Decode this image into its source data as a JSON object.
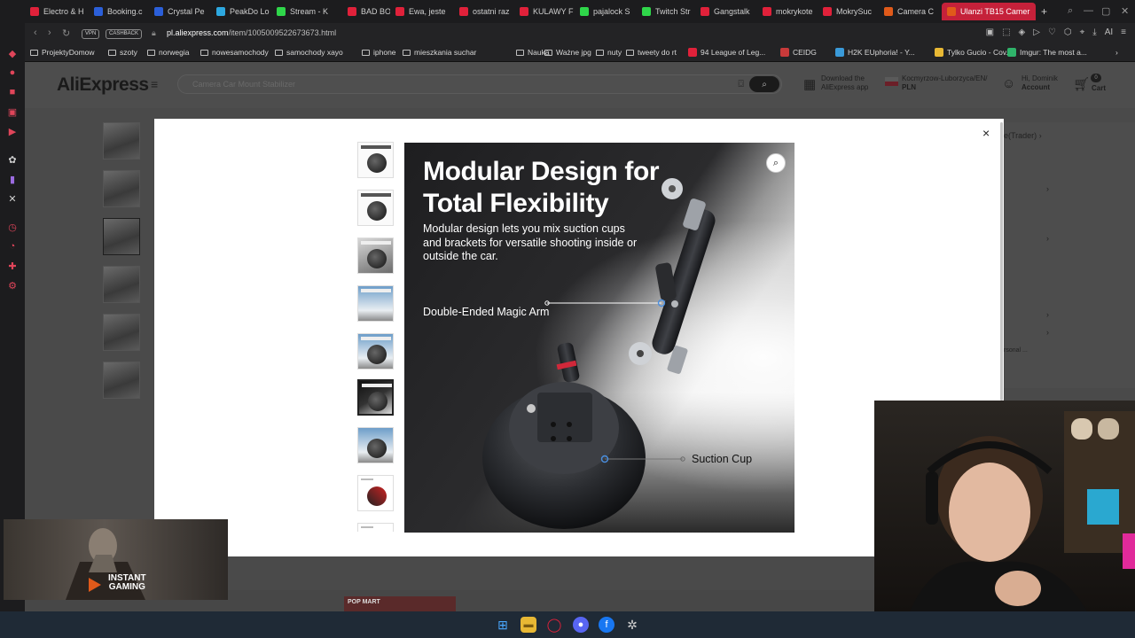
{
  "browser": {
    "tabs": [
      {
        "label": "Electro & H",
        "color": "#e0213a"
      },
      {
        "label": "Booking.c",
        "color": "#2b5fd9"
      },
      {
        "label": "Crystal Pe",
        "color": "#2b5fd9"
      },
      {
        "label": "PeakDo Lo",
        "color": "#2da8e0"
      },
      {
        "label": "Stream - K",
        "color": "#2fd64a"
      },
      {
        "label": "BAD BOY",
        "color": "#e0213a"
      },
      {
        "label": "Ewa, jeste",
        "color": "#e0213a"
      },
      {
        "label": "ostatni raz",
        "color": "#e0213a"
      },
      {
        "label": "KULAWY F",
        "color": "#e0213a"
      },
      {
        "label": "pajalock S",
        "color": "#2fd64a"
      },
      {
        "label": "Twitch Str",
        "color": "#2fd64a"
      },
      {
        "label": "Gangstalk",
        "color": "#e0213a"
      },
      {
        "label": "mokrykote",
        "color": "#e0213a"
      },
      {
        "label": "MokrySuc",
        "color": "#e0213a"
      },
      {
        "label": "Camera C",
        "color": "#e05a1a"
      },
      {
        "label": "Ulanzi TB15 Camer",
        "color": "#e05a1a"
      }
    ],
    "new_tab": "+",
    "vpn_chip": "VPN",
    "cashback_chip": "CASHBACK",
    "url_domain": "pl.aliexpress.com",
    "url_path": "/item/1005009522673673.html",
    "bookmarks": [
      {
        "label": "ProjektyDomow",
        "type": "folder"
      },
      {
        "label": "szoty",
        "type": "folder"
      },
      {
        "label": "norwegia",
        "type": "folder"
      },
      {
        "label": "nowesamochody",
        "type": "folder"
      },
      {
        "label": "samochody xayo",
        "type": "folder"
      },
      {
        "label": "iphone",
        "type": "folder"
      },
      {
        "label": "mieszkania suchar",
        "type": "folder"
      },
      {
        "label": "Nauka",
        "type": "folder"
      },
      {
        "label": "Ważne jpg",
        "type": "folder"
      },
      {
        "label": "nuty",
        "type": "folder"
      },
      {
        "label": "tweety do rt",
        "type": "folder"
      },
      {
        "label": "94 League of Leg...",
        "type": "site"
      },
      {
        "label": "CEIDG",
        "type": "site"
      },
      {
        "label": "H2K EUphoria! - Y...",
        "type": "site"
      },
      {
        "label": "Tylko Gucio - Cov...",
        "type": "site"
      },
      {
        "label": "Imgur: The most a...",
        "type": "site"
      }
    ]
  },
  "aliexpress": {
    "logo": "AliExpress",
    "search_placeholder": "Camera Car Mount Stabilizer",
    "download_app": [
      "Download the",
      "AliExpress app"
    ],
    "ship_to": "Kocmyrzow-Luborzyca/EN/",
    "currency": "PLN",
    "greeting": "Hi, Dominik",
    "account": "Account",
    "cart_count": "0",
    "cart": "Cart",
    "store_link": "e(Trader)",
    "personal_text": "rsonal ...",
    "popmart": "POP MART"
  },
  "modal": {
    "close": "×",
    "image_title_line1": "Modular Design for",
    "image_title_line2": "Total Flexibility",
    "image_subtitle": "Modular design lets you mix suction cups and brackets for versatile shooting inside or outside the car.",
    "label_arm": "Double-Ended Magic Arm",
    "label_cup": "Suction Cup",
    "thumb_count": 9,
    "selected_thumb": 6
  },
  "overlay": {
    "game_ad_line1": "INSTANT",
    "game_ad_line2": "GAMING"
  }
}
